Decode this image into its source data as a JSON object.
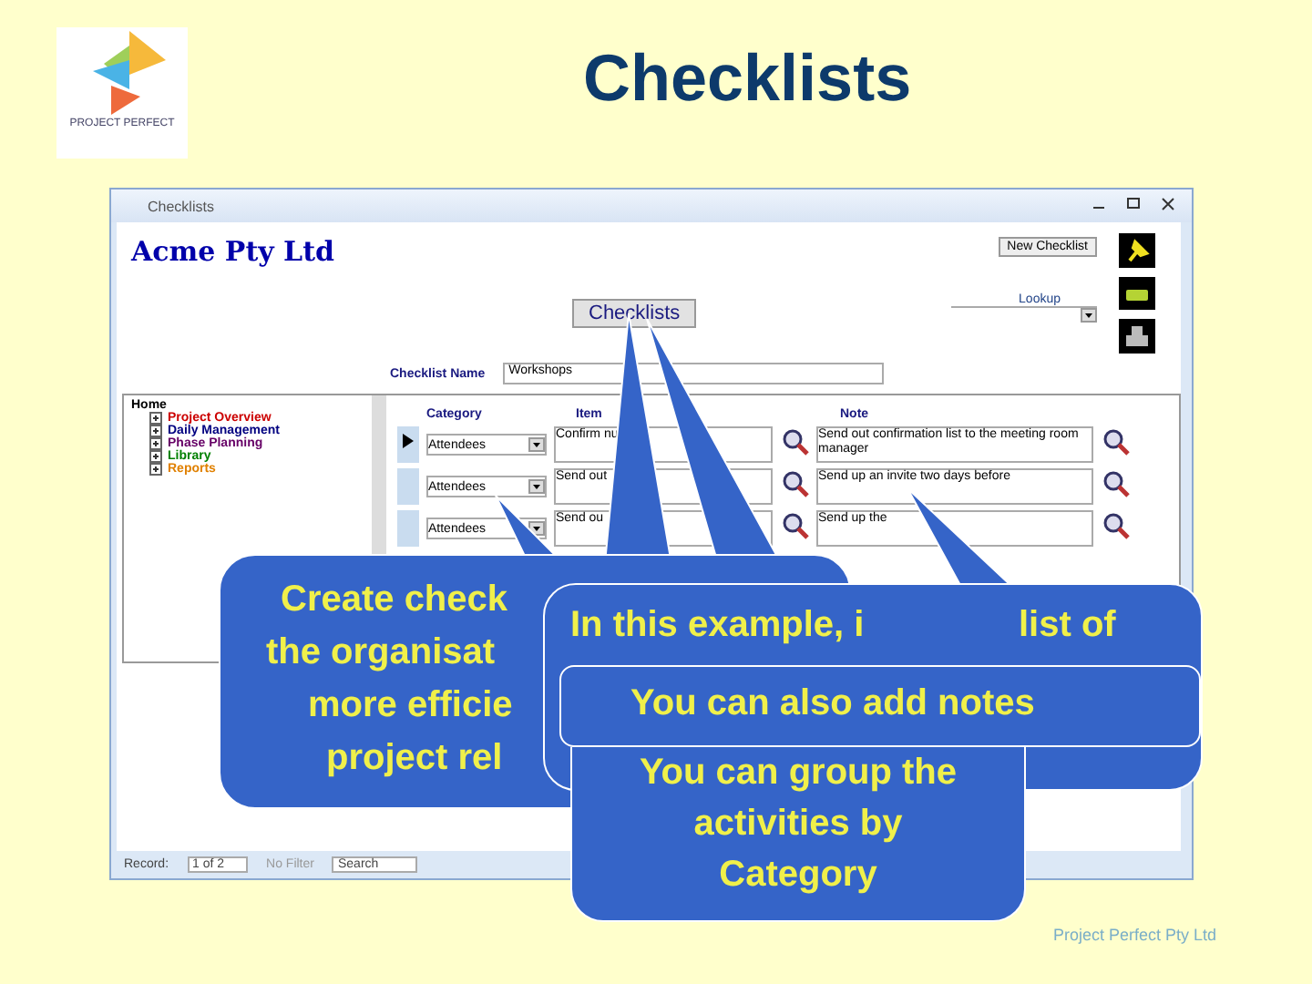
{
  "slide": {
    "title": "Checklists",
    "logo_text": "PROJECT PERFECT",
    "footer": "Project Perfect Pty Ltd"
  },
  "window": {
    "title": "Checklists",
    "company": "Acme Pty Ltd",
    "new_button": "New Checklist",
    "center_button": "Checklists",
    "lookup_label": "Lookup",
    "name_label": "Checklist Name",
    "name_value": "Workshops",
    "tree": {
      "label": "Home",
      "children": [
        {
          "label": "Project Overview",
          "color": "#cc0000"
        },
        {
          "label": "Daily Management",
          "color": "#000080"
        },
        {
          "label": "Phase Planning",
          "color": "#660066"
        },
        {
          "label": "Library",
          "color": "#008000"
        },
        {
          "label": "Reports",
          "color": "#e08000"
        }
      ]
    },
    "columns": [
      "Category",
      "Item",
      "Note"
    ],
    "rows": [
      {
        "selected": true,
        "category": "Attendees",
        "item": "Confirm nu",
        "note": "Send out confirmation list to the meeting room manager"
      },
      {
        "selected": false,
        "category": "Attendees",
        "item": "Send out",
        "note": "Send up an invite two days before"
      },
      {
        "selected": false,
        "category": "Attendees",
        "item": "Send ou",
        "note": "Send up the"
      }
    ],
    "status": {
      "label": "Record:",
      "position": "1 of 2",
      "filter": "No Filter",
      "search": "Search"
    }
  },
  "callouts": [
    {
      "lines": [
        "Create check",
        "the organisat",
        "more efficie",
        "project rel"
      ]
    },
    {
      "lines": [
        "In this example, i",
        "list of"
      ]
    },
    {
      "lines": [
        "You can also add notes"
      ]
    },
    {
      "lines": [
        "You can group the",
        "activities by",
        "Category"
      ]
    }
  ]
}
